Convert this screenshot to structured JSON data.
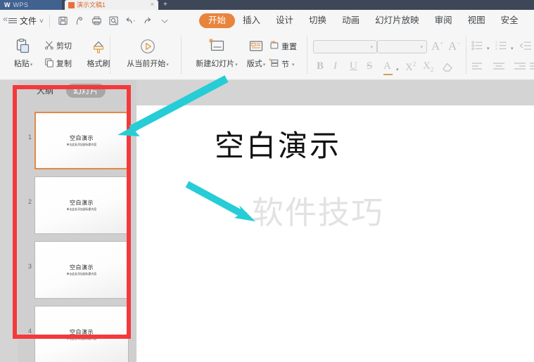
{
  "app": {
    "suite_name": "WPS",
    "document_tab": "演示文稿1",
    "close_tab_glyph": "×",
    "new_tab_glyph": "+"
  },
  "quick_access": {
    "file_label": "文件",
    "file_caret": "∨",
    "icons": [
      {
        "name": "save-icon"
      },
      {
        "name": "save-as-cloud-icon"
      },
      {
        "name": "print-icon"
      },
      {
        "name": "print-preview-icon"
      },
      {
        "name": "undo-icon"
      },
      {
        "name": "redo-icon"
      },
      {
        "name": "customize-qat-icon"
      }
    ]
  },
  "ribbon": {
    "tabs": [
      {
        "label": "开始",
        "active": true
      },
      {
        "label": "插入",
        "active": false
      },
      {
        "label": "设计",
        "active": false
      },
      {
        "label": "切换",
        "active": false
      },
      {
        "label": "动画",
        "active": false
      },
      {
        "label": "幻灯片放映",
        "active": false
      },
      {
        "label": "审阅",
        "active": false
      },
      {
        "label": "视图",
        "active": false
      },
      {
        "label": "安全",
        "active": false
      }
    ],
    "clipboard": {
      "paste": "粘贴",
      "cut": "剪切",
      "copy": "复制",
      "format_painter": "格式刷",
      "caret": "▾"
    },
    "present": {
      "start_from_current": "从当前开始",
      "caret": "▾"
    },
    "slides": {
      "new_slide": "新建幻灯片",
      "layout": "版式",
      "reset": "重置",
      "section": "节",
      "caret": "▾"
    },
    "font": {
      "font_name_value": "",
      "font_name_placeholder": "",
      "font_size_value": "",
      "font_size_placeholder": "",
      "grow_font": "A",
      "grow_sup": "+",
      "shrink_font": "A",
      "shrink_sup": "−",
      "bold": "B",
      "italic": "I",
      "underline": "U",
      "strikethrough": "S",
      "text_color": "A",
      "superscript": "X",
      "superscript_sup": "2",
      "subscript": "X",
      "subscript_sub": "2",
      "clear_format": "clear-format-icon",
      "caret": "▾"
    },
    "paragraph": {
      "bullets": "bullet-list-icon",
      "numbering": "numbered-list-icon",
      "decrease_indent": "decrease-indent-icon",
      "align_left": "align-left-icon",
      "align_center": "align-center-icon",
      "align_right": "align-right-icon",
      "align_justify": "align-justify-icon",
      "caret": "▾"
    }
  },
  "panel": {
    "collapse_glyph": "«",
    "tabs": [
      {
        "label": "大纲",
        "active": false
      },
      {
        "label": "幻灯片",
        "active": true
      }
    ],
    "slides": [
      {
        "number": "1",
        "title": "空白演示",
        "subtitle": "单击此处添加副标题内容",
        "selected": true
      },
      {
        "number": "2",
        "title": "空白演示",
        "subtitle": "单击此处添加副标题内容",
        "selected": false
      },
      {
        "number": "3",
        "title": "空白演示",
        "subtitle": "单击此处添加副标题内容",
        "selected": false
      },
      {
        "number": "4",
        "title": "空白演示",
        "subtitle": "单击此处添加副标题内容",
        "selected": false
      }
    ]
  },
  "editor": {
    "slide_title": "空白演示",
    "watermark": "软件技巧"
  },
  "annotations": {
    "highlight_color": "#f4393c",
    "arrow_color": "#27cdd6",
    "arrows": [
      {
        "name": "arrow-to-slide-panel"
      },
      {
        "name": "arrow-to-slide-canvas"
      }
    ]
  },
  "colors": {
    "accent_orange": "#e8843c",
    "titlebar": "#3d4758",
    "wps_blue": "#41618f",
    "workspace_gray": "#d4d4d4",
    "panel_gray": "#cfcfcf"
  }
}
